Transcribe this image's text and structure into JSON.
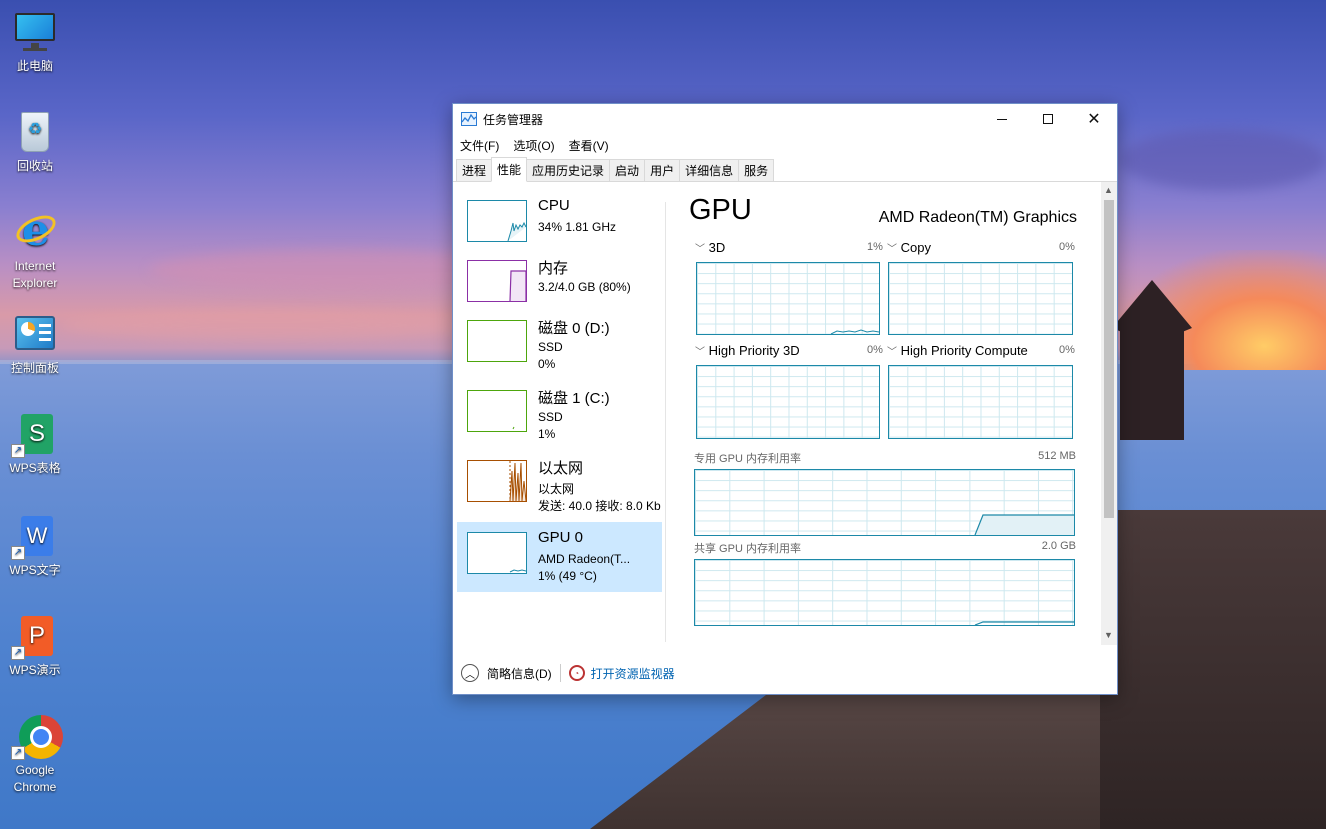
{
  "desktop": {
    "icons": [
      {
        "label": "此电脑",
        "icon": "computer-icon"
      },
      {
        "label": "回收站",
        "icon": "recycle-bin-icon"
      },
      {
        "label": "Internet Explorer",
        "icon": "internet-explorer-icon"
      },
      {
        "label": "控制面板",
        "icon": "control-panel-icon"
      },
      {
        "label": "WPS表格",
        "icon": "wps-spreadsheet-icon"
      },
      {
        "label": "WPS文字",
        "icon": "wps-writer-icon"
      },
      {
        "label": "WPS演示",
        "icon": "wps-presentation-icon"
      },
      {
        "label": "Google Chrome",
        "icon": "chrome-icon"
      }
    ]
  },
  "window": {
    "title": "任务管理器",
    "menu": [
      "文件(F)",
      "选项(O)",
      "查看(V)"
    ],
    "tabs": [
      "进程",
      "性能",
      "应用历史记录",
      "启动",
      "用户",
      "详细信息",
      "服务"
    ],
    "active_tab": "性能",
    "colors": {
      "cpu": "#1c89a8",
      "memory": "#8b2fa6",
      "disk": "#4da60c",
      "ethernet": "#a74f01",
      "gpu": "#1c89a8",
      "selected": "#cce8ff"
    },
    "resources": [
      {
        "name": "CPU",
        "line1": "34% 1.81 GHz",
        "line2": ""
      },
      {
        "name": "内存",
        "line1": "3.2/4.0 GB (80%)",
        "line2": ""
      },
      {
        "name": "磁盘 0 (D:)",
        "line1": "SSD",
        "line2": "0%"
      },
      {
        "name": "磁盘 1 (C:)",
        "line1": "SSD",
        "line2": "1%"
      },
      {
        "name": "以太网",
        "line1": "以太网",
        "line2": "发送: 40.0  接收: 8.0 Kb"
      },
      {
        "name": "GPU 0",
        "line1": "AMD Radeon(T...",
        "line2": "1% (49 °C)"
      }
    ],
    "gpu": {
      "title": "GPU",
      "name": "AMD Radeon(TM) Graphics",
      "engines": [
        {
          "label": "3D",
          "pct": "1%"
        },
        {
          "label": "Copy",
          "pct": "0%"
        },
        {
          "label": "High Priority 3D",
          "pct": "0%"
        },
        {
          "label": "High Priority Compute",
          "pct": "0%"
        }
      ],
      "dedicated_label": "专用 GPU 内存利用率",
      "dedicated_value": "512 MB",
      "shared_label": "共享 GPU 内存利用率",
      "shared_value": "2.0 GB"
    },
    "footer": {
      "fewer_details": "简略信息(D)",
      "open_monitor": "打开资源监视器"
    }
  }
}
